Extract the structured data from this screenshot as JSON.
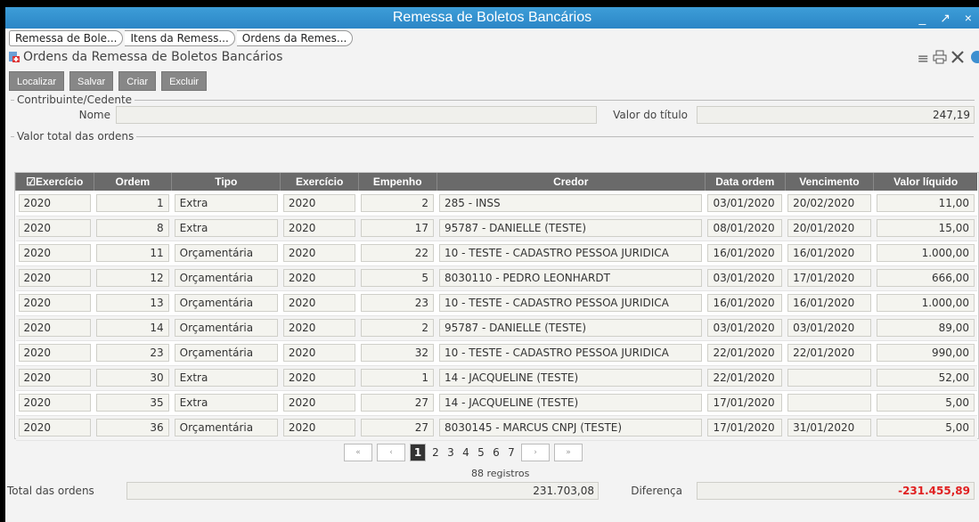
{
  "window": {
    "title": "Remessa de Boletos Bancários",
    "controls": "_ ↗ ×"
  },
  "breadcrumbs": [
    "Remessa de Bole...",
    "Itens da Remess...",
    "Ordens da Remes..."
  ],
  "page": {
    "title": "Ordens da Remessa de Boletos Bancários"
  },
  "toolbar": {
    "localizar": "Localizar",
    "salvar": "Salvar",
    "criar": "Criar",
    "excluir": "Excluir"
  },
  "contribuinte": {
    "legend": "Contribuinte/Cedente",
    "nome_label": "Nome",
    "nome_value": "",
    "valor_label": "Valor do título",
    "valor_value": "247,19"
  },
  "ordens": {
    "legend": "Valor total das ordens",
    "columns": [
      "Exercício",
      "Ordem",
      "Tipo",
      "Exercício",
      "Empenho",
      "Credor",
      "Data ordem",
      "Vencimento",
      "Valor líquido"
    ],
    "rows": [
      [
        "2020",
        "1",
        "Extra",
        "2020",
        "2",
        "285 - INSS",
        "03/01/2020",
        "20/02/2020",
        "11,00"
      ],
      [
        "2020",
        "8",
        "Extra",
        "2020",
        "17",
        "95787 - DANIELLE  (TESTE)",
        "08/01/2020",
        "20/01/2020",
        "15,00"
      ],
      [
        "2020",
        "11",
        "Orçamentária",
        "2020",
        "22",
        "10 - TESTE - CADASTRO PESSOA JURIDICA",
        "16/01/2020",
        "16/01/2020",
        "1.000,00"
      ],
      [
        "2020",
        "12",
        "Orçamentária",
        "2020",
        "5",
        "8030110 - PEDRO LEONHARDT",
        "03/01/2020",
        "17/01/2020",
        "666,00"
      ],
      [
        "2020",
        "13",
        "Orçamentária",
        "2020",
        "23",
        "10 - TESTE - CADASTRO PESSOA JURIDICA",
        "16/01/2020",
        "16/01/2020",
        "1.000,00"
      ],
      [
        "2020",
        "14",
        "Orçamentária",
        "2020",
        "2",
        "95787 - DANIELLE  (TESTE)",
        "03/01/2020",
        "03/01/2020",
        "89,00"
      ],
      [
        "2020",
        "23",
        "Orçamentária",
        "2020",
        "32",
        "10 - TESTE - CADASTRO PESSOA JURIDICA",
        "22/01/2020",
        "22/01/2020",
        "990,00"
      ],
      [
        "2020",
        "30",
        "Extra",
        "2020",
        "1",
        "14 - JACQUELINE (TESTE)",
        "22/01/2020",
        "",
        "52,00"
      ],
      [
        "2020",
        "35",
        "Extra",
        "2020",
        "27",
        "14 - JACQUELINE (TESTE)",
        "17/01/2020",
        "",
        "5,00"
      ],
      [
        "2020",
        "36",
        "Orçamentária",
        "2020",
        "27",
        "8030145 - MARCUS CNPJ (TESTE)",
        "17/01/2020",
        "31/01/2020",
        "5,00"
      ]
    ]
  },
  "pager": {
    "first": "«",
    "prev": "‹",
    "current": "1",
    "pages": [
      "2",
      "3",
      "4",
      "5",
      "6",
      "7"
    ],
    "next": "›",
    "last": "»",
    "registros": "88 registros"
  },
  "totals": {
    "total_label": "Total das ordens",
    "total_value": "231.703,08",
    "diferenca_label": "Diferença",
    "diferenca_value": "-231.455,89"
  }
}
